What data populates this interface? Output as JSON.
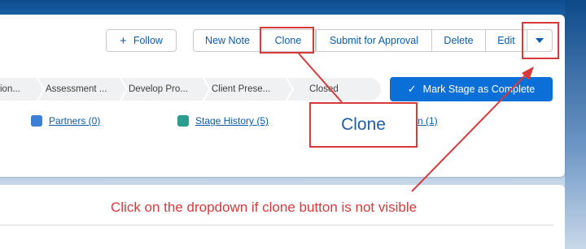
{
  "header": {
    "follow_label": "Follow",
    "actions": [
      "New Note",
      "Clone",
      "Submit for Approval",
      "Delete",
      "Edit"
    ]
  },
  "path": {
    "stages": [
      "ion...",
      "Assessment ...",
      "Develop Pro...",
      "Client Prese...",
      "Closed"
    ],
    "mark_complete_label": "Mark Stage as Complete"
  },
  "related": {
    "partners": "Partners (0)",
    "stage_history": "Stage History (5)",
    "partial_link": "n (1)"
  },
  "annotations": {
    "clone_callout": "Clone",
    "instruction": "Click on the dropdown if clone button is not visible",
    "highlight_color": "#d83a3a"
  },
  "icons": {
    "follow": "plus-icon",
    "dropdown": "chevron-down-icon",
    "mark_complete": "check-icon",
    "partners": "partners-icon",
    "stage_history": "stage-history-icon"
  }
}
